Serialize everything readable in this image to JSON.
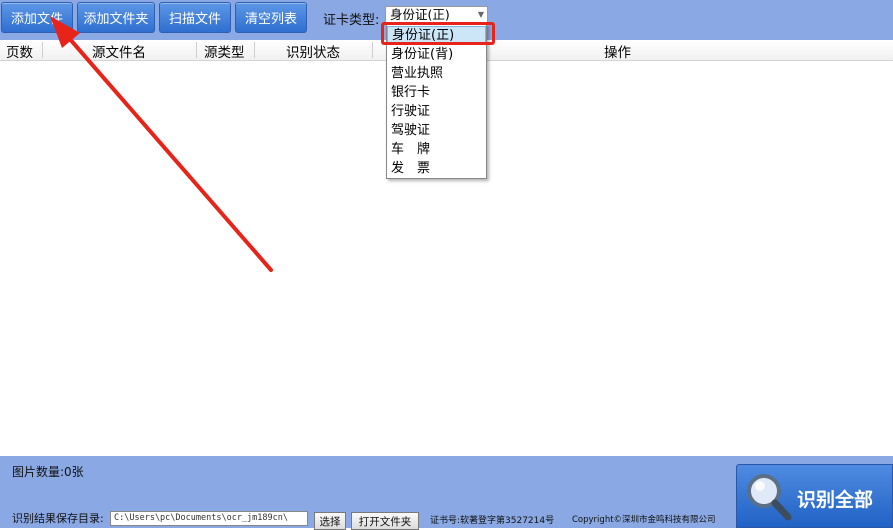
{
  "toolbar": {
    "add_file": "添加文件",
    "add_folder": "添加文件夹",
    "scan_file": "扫描文件",
    "clear_list": "清空列表",
    "card_type_label": "证卡类型:",
    "card_type_value": "身份证(正)"
  },
  "table": {
    "columns": [
      "页数",
      "源文件名",
      "源类型",
      "识别状态",
      "操作"
    ]
  },
  "dropdown": {
    "options": [
      "身份证(正)",
      "身份证(背)",
      "营业执照",
      "银行卡",
      "行驶证",
      "驾驶证",
      "车　牌",
      "发　票"
    ],
    "selected_index": 0
  },
  "statusbar": {
    "image_count": "图片数量:0张",
    "save_dir_label": "识别结果保存目录:",
    "save_dir_value": "C:\\Users\\pc\\Documents\\ocr_jm189cn\\",
    "choose_button": "选择",
    "open_folder_button": "打开文件夹",
    "certificate": "证书号:软著登字第3527214号",
    "copyright": "Copyright©深圳市金鸣科技有限公司",
    "recognize_all": "识别全部"
  },
  "colors": {
    "toolbar_bg": "#8aa8e4",
    "button_blue": "#2f6fd0",
    "annotation_red": "#e8231a"
  },
  "icons": {
    "recognize_all_icon": "magnifier-icon",
    "select_arrow": "chevron-down-icon"
  }
}
